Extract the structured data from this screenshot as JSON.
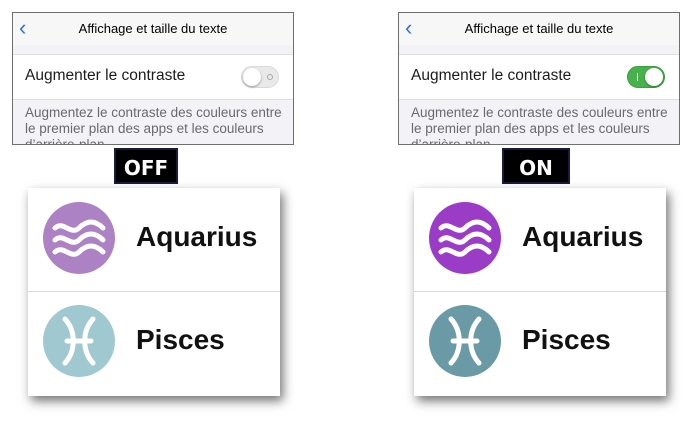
{
  "panels": [
    {
      "settings": {
        "back_icon": "chevron-left-icon",
        "title": "Affichage et taille du texte",
        "row_label": "Augmenter le contraste",
        "toggle_state": "off",
        "description": "Augmentez le contraste des couleurs entre le premier plan des apps et les couleurs d’arrière-plan."
      },
      "state_label": "OFF",
      "signs": [
        {
          "name": "Aquarius",
          "icon": "aquarius-icon",
          "color": "#ac82c5"
        },
        {
          "name": "Pisces",
          "icon": "pisces-icon",
          "color": "#9fc8d0"
        }
      ]
    },
    {
      "settings": {
        "back_icon": "chevron-left-icon",
        "title": "Affichage et taille du texte",
        "row_label": "Augmenter le contraste",
        "toggle_state": "on",
        "description": "Augmentez le contraste des couleurs entre le premier plan des apps et les couleurs d’arrière-plan."
      },
      "state_label": "ON",
      "signs": [
        {
          "name": "Aquarius",
          "icon": "aquarius-icon",
          "color": "#9a3cc6"
        },
        {
          "name": "Pisces",
          "icon": "pisces-icon",
          "color": "#6a9aa6"
        }
      ]
    }
  ],
  "colors": {
    "toggle_on": "#47b24b",
    "toggle_off": "#e9e9ea",
    "link": "#2f6fe0"
  }
}
